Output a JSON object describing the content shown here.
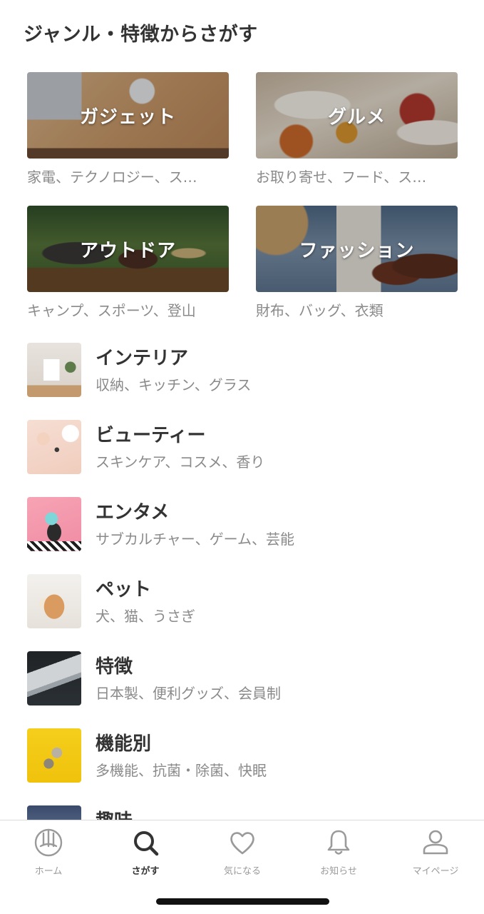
{
  "page": {
    "title": "ジャンル・特徴からさがす"
  },
  "featured": [
    {
      "label": "ガジェット",
      "sub": "家電、テクノロジー、ス…"
    },
    {
      "label": "グルメ",
      "sub": "お取り寄せ、フード、ス…"
    },
    {
      "label": "アウトドア",
      "sub": "キャンプ、スポーツ、登山"
    },
    {
      "label": "ファッション",
      "sub": "財布、バッグ、衣類"
    }
  ],
  "genres": [
    {
      "title": "インテリア",
      "sub": "収納、キッチン、グラス"
    },
    {
      "title": "ビューティー",
      "sub": "スキンケア、コスメ、香り"
    },
    {
      "title": "エンタメ",
      "sub": "サブカルチャー、ゲーム、芸能"
    },
    {
      "title": "ペット",
      "sub": "犬、猫、うさぎ"
    },
    {
      "title": "特徴",
      "sub": "日本製、便利グッズ、会員制"
    },
    {
      "title": "機能別",
      "sub": "多機能、抗菌・除菌、快眠"
    },
    {
      "title": "趣味",
      "sub": ""
    }
  ],
  "nav": {
    "items": [
      {
        "label": "ホーム",
        "icon": "home-icon"
      },
      {
        "label": "さがす",
        "icon": "search-icon"
      },
      {
        "label": "気になる",
        "icon": "heart-icon"
      },
      {
        "label": "お知らせ",
        "icon": "bell-icon"
      },
      {
        "label": "マイページ",
        "icon": "user-icon"
      }
    ],
    "active_index": 1,
    "active_color": "#333333",
    "inactive_color": "#9a9a9a"
  }
}
